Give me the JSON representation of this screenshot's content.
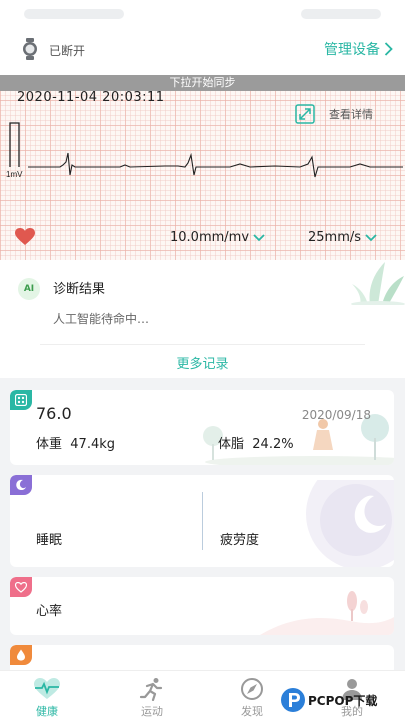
{
  "device": {
    "status": "已断开",
    "manage_label": "管理设备"
  },
  "ecg": {
    "sync_banner": "下拉开始同步",
    "datetime": "2020-11-04 20:03:11",
    "detail_label": "查看详情",
    "calibration_label": "1mV",
    "gain": "10.0mm/mv",
    "speed": "25mm/s"
  },
  "diagnosis": {
    "badge": "AI",
    "title": "诊断结果",
    "status": "人工智能待命中…",
    "more_label": "更多记录"
  },
  "weight": {
    "value": "76.0",
    "date": "2020/09/18",
    "weight_label": "体重",
    "weight_value": "47.4kg",
    "fat_label": "体脂",
    "fat_value": "24.2%"
  },
  "sleep": {
    "sleep_label": "睡眠",
    "fatigue_label": "疲劳度"
  },
  "heart_rate": {
    "label": "心率"
  },
  "tabs": [
    {
      "label": "健康"
    },
    {
      "label": "运动"
    },
    {
      "label": "发现"
    },
    {
      "label": "我的"
    }
  ],
  "watermark": {
    "text": "PCPOP下载"
  },
  "colors": {
    "accent": "#2ab7a4",
    "ecg_grid": "#ebafa5",
    "heart": "#e0584f",
    "weight_badge": "#2ab7a4",
    "sleep_badge": "#8a6fd6",
    "heart_badge": "#ef6f8a",
    "peek_badge": "#f08a3c"
  }
}
